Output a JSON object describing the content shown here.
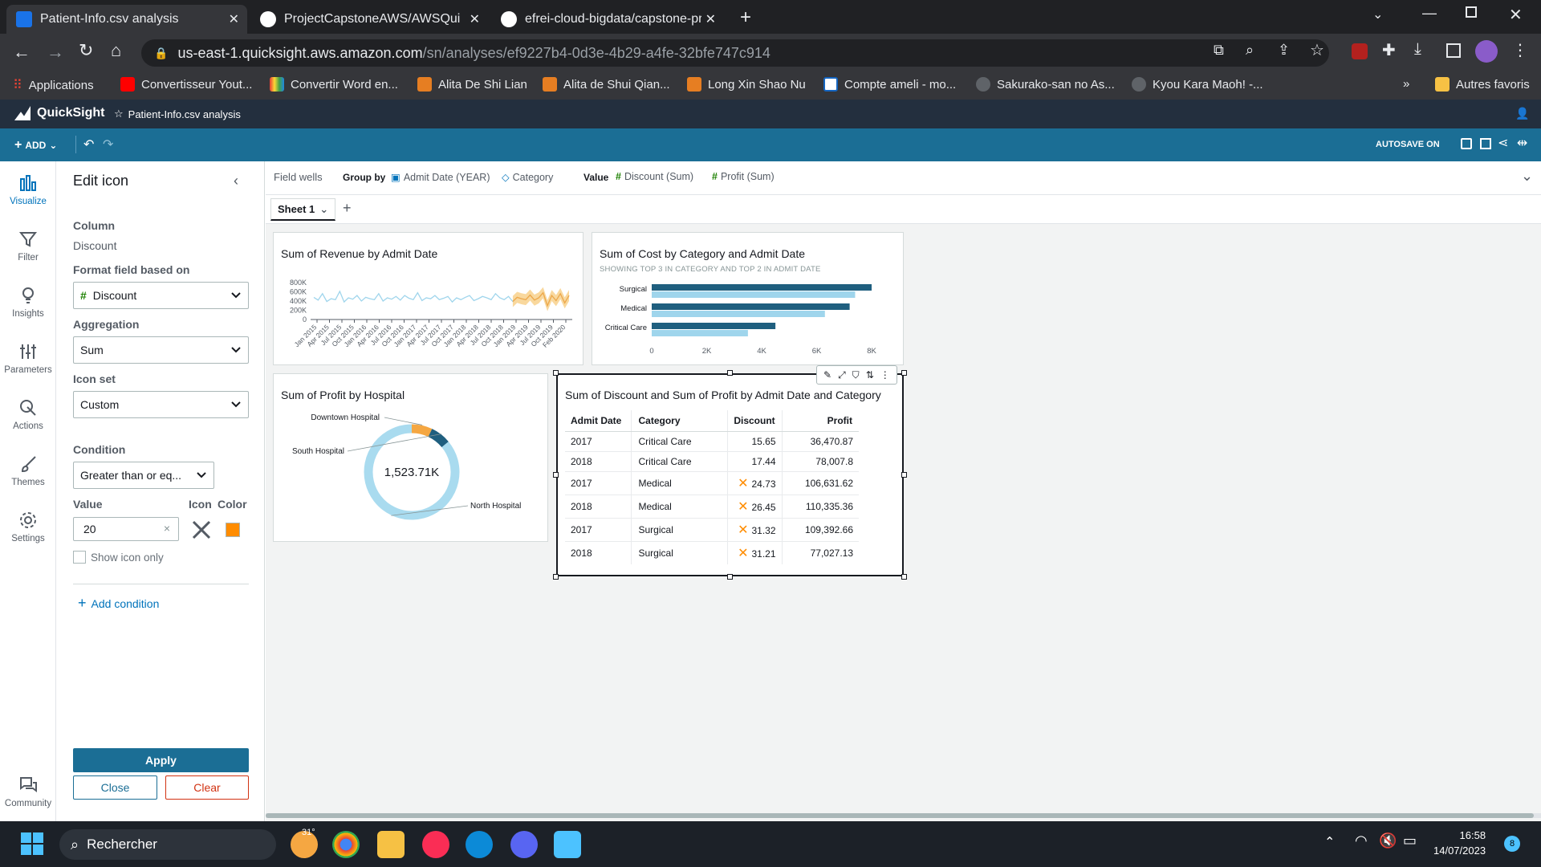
{
  "browser": {
    "tabs": [
      {
        "title": "Patient-Info.csv analysis",
        "active": true
      },
      {
        "title": "ProjectCapstoneAWS/AWSQuickS",
        "active": false
      },
      {
        "title": "efrei-cloud-bigdata/capstone-pr",
        "active": false
      }
    ],
    "url_domain": "us-east-1.quicksight.aws.amazon.com",
    "url_path": "/sn/analyses/ef9227b4-0d3e-4b29-a4fe-32bfe747c914",
    "bookmarks": [
      "Applications",
      "Convertisseur Yout...",
      "Convertir Word en...",
      "Alita De Shi Lian",
      "Alita de Shui Qian...",
      "Long Xin Shao Nu",
      "Compte ameli - mo...",
      "Sakurako-san no As...",
      "Kyou Kara Maoh! -..."
    ],
    "bookmarks_more": "»",
    "other_bookmarks": "Autres favoris"
  },
  "quicksight": {
    "brand": "QuickSight",
    "analysis_name": "Patient-Info.csv analysis",
    "add_label": "ADD",
    "autosave_label": "AUTOSAVE ON"
  },
  "rail": [
    {
      "label": "Visualize",
      "icon": "bar-chart-icon",
      "active": true
    },
    {
      "label": "Filter",
      "icon": "filter-icon",
      "active": false
    },
    {
      "label": "Insights",
      "icon": "lightbulb-icon",
      "active": false
    },
    {
      "label": "Parameters",
      "icon": "sliders-icon",
      "active": false
    },
    {
      "label": "Actions",
      "icon": "pointer-icon",
      "active": false
    },
    {
      "label": "Themes",
      "icon": "brush-icon",
      "active": false
    },
    {
      "label": "Settings",
      "icon": "gear-icon",
      "active": false
    }
  ],
  "rail_bottom": {
    "label": "Community",
    "icon": "chat-icon"
  },
  "panel": {
    "title": "Edit icon",
    "column_label": "Column",
    "column_value": "Discount",
    "format_field_label": "Format field based on",
    "format_field_value": "Discount",
    "aggregation_label": "Aggregation",
    "aggregation_value": "Sum",
    "icon_set_label": "Icon set",
    "icon_set_value": "Custom",
    "condition_label": "Condition",
    "condition_value": "Greater than or eq...",
    "value_label": "Value",
    "icon_label": "Icon",
    "color_label": "Color",
    "value_input": "20",
    "icon_color": "#545b64",
    "swatch_color": "#ff8c00",
    "show_icon_only": "Show icon only",
    "add_condition": "Add condition",
    "apply": "Apply",
    "close": "Close",
    "clear": "Clear"
  },
  "fieldwells": {
    "title": "Field wells",
    "group_by_label": "Group by",
    "group_by": [
      "Admit Date (YEAR)",
      "Category"
    ],
    "value_label": "Value",
    "values": [
      "Discount (Sum)",
      "Profit (Sum)"
    ]
  },
  "sheet": {
    "tab": "Sheet 1"
  },
  "visuals": {
    "revenue": {
      "title": "Sum of Revenue by Admit Date",
      "chart_data": {
        "type": "line",
        "y_ticks": [
          "800K",
          "600K",
          "400K",
          "200K",
          "0"
        ],
        "ylim": [
          0,
          800000
        ],
        "x_ticks": [
          "Jan 2015",
          "Apr 2015",
          "Jul 2015",
          "Oct 2015",
          "Jan 2016",
          "Apr 2016",
          "Jul 2016",
          "Oct 2016",
          "Jan 2017",
          "Apr 2017",
          "Jul 2017",
          "Oct 2017",
          "Jan 2018",
          "Apr 2018",
          "Jul 2018",
          "Oct 2018",
          "Jan 2019",
          "Apr 2019",
          "Jul 2019",
          "Oct 2019",
          "Feb 2020"
        ],
        "values": [
          480000,
          420000,
          560000,
          390000,
          450000,
          430000,
          610000,
          380000,
          470000,
          440000,
          520000,
          400000,
          480000,
          450000,
          430000,
          560000,
          400000,
          470000,
          440000,
          500000,
          420000,
          520000,
          460000,
          430000,
          580000,
          410000,
          470000,
          450000,
          520000,
          430000,
          460000,
          500000,
          380000,
          470000,
          430000,
          480000,
          520000,
          410000,
          450000,
          500000,
          470000,
          430000,
          560000,
          470000,
          430000,
          500000,
          390000,
          480000,
          450000,
          430000,
          530000,
          420000,
          470000,
          580000,
          300000,
          520000,
          410000,
          560000,
          360000,
          520000
        ],
        "forecast_band_color": "#f7c873",
        "line_color": "#9fd5ec"
      }
    },
    "cost": {
      "title": "Sum of Cost by Category and Admit Date",
      "subtitle": "SHOWING TOP 3 IN CATEGORY AND TOP 2 IN ADMIT DATE",
      "chart_data": {
        "type": "bar",
        "orientation": "horizontal",
        "categories": [
          "Surgical",
          "Medical",
          "Critical Care"
        ],
        "series": [
          {
            "values": [
              8000,
              7200,
              4500
            ],
            "color": "#1f5f7f"
          },
          {
            "values": [
              7400,
              6300,
              3500
            ],
            "color": "#9fd5ec"
          }
        ],
        "x_ticks": [
          "0",
          "2K",
          "4K",
          "6K",
          "8K"
        ],
        "xlim": [
          0,
          8000
        ]
      }
    },
    "profit": {
      "title": "Sum of Profit by Hospital",
      "center_label": "1,523.71K",
      "chart_data": {
        "type": "pie",
        "labels": [
          "Downtown Hospital",
          "South Hospital",
          "North Hospital"
        ],
        "values": [
          0.07,
          0.07,
          0.86
        ],
        "colors": [
          "#f5a742",
          "#1f5f7f",
          "#a9dbef"
        ]
      }
    },
    "table": {
      "title": "Sum of Discount and Sum of Profit by Admit Date and Category",
      "headers": [
        "Admit Date",
        "Category",
        "Discount",
        "Profit"
      ],
      "rows": [
        {
          "date": "2017",
          "category": "Critical Care",
          "discount": "15.65",
          "profit": "36,470.87",
          "flag": false
        },
        {
          "date": "2018",
          "category": "Critical Care",
          "discount": "17.44",
          "profit": "78,007.8",
          "flag": false
        },
        {
          "date": "2017",
          "category": "Medical",
          "discount": "24.73",
          "profit": "106,631.62",
          "flag": true
        },
        {
          "date": "2018",
          "category": "Medical",
          "discount": "26.45",
          "profit": "110,335.36",
          "flag": true
        },
        {
          "date": "2017",
          "category": "Surgical",
          "discount": "31.32",
          "profit": "109,392.66",
          "flag": true
        },
        {
          "date": "2018",
          "category": "Surgical",
          "discount": "31.21",
          "profit": "77,027.13",
          "flag": true
        }
      ],
      "flag_color": "#ff8c00"
    }
  },
  "taskbar": {
    "search": "Rechercher",
    "weather": "31°",
    "time": "16:58",
    "date": "14/07/2023",
    "notifications": "8"
  }
}
